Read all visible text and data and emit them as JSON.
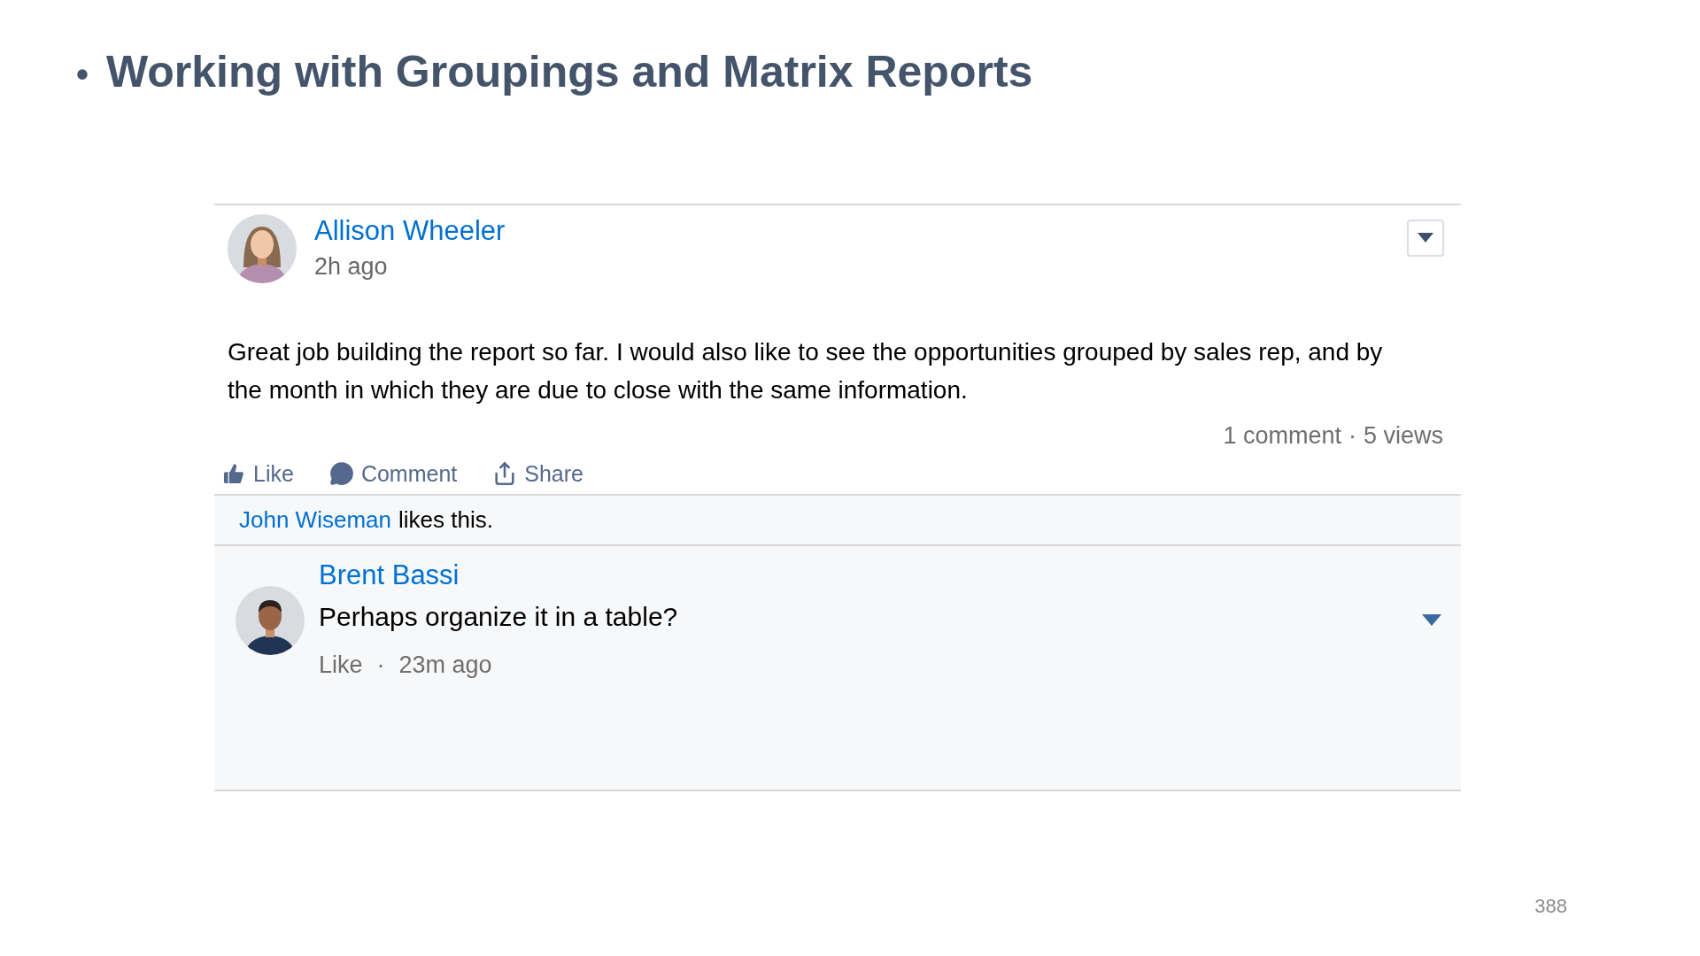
{
  "slide": {
    "bullet": "•",
    "title": "Working with Groupings and Matrix Reports",
    "page_number": "388"
  },
  "post": {
    "author": "Allison Wheeler",
    "time": "2h ago",
    "body": "Great job building the report so far. I would also like to see the opportunities grouped by sales rep, and by the month in which they are due to close with the same information.",
    "stats": {
      "comments": "1 comment",
      "separator": "·",
      "views": "5 views"
    },
    "actions": [
      {
        "kind": "like",
        "label": "Like"
      },
      {
        "kind": "comment",
        "label": "Comment"
      },
      {
        "kind": "share",
        "label": "Share"
      }
    ],
    "likes": {
      "name": "John Wiseman",
      "text": "likes this."
    },
    "comments": [
      {
        "author": "Brent Bassi",
        "text": "Perhaps organize it in a table?",
        "like": "Like",
        "separator": "·",
        "time": "23m ago"
      }
    ]
  }
}
